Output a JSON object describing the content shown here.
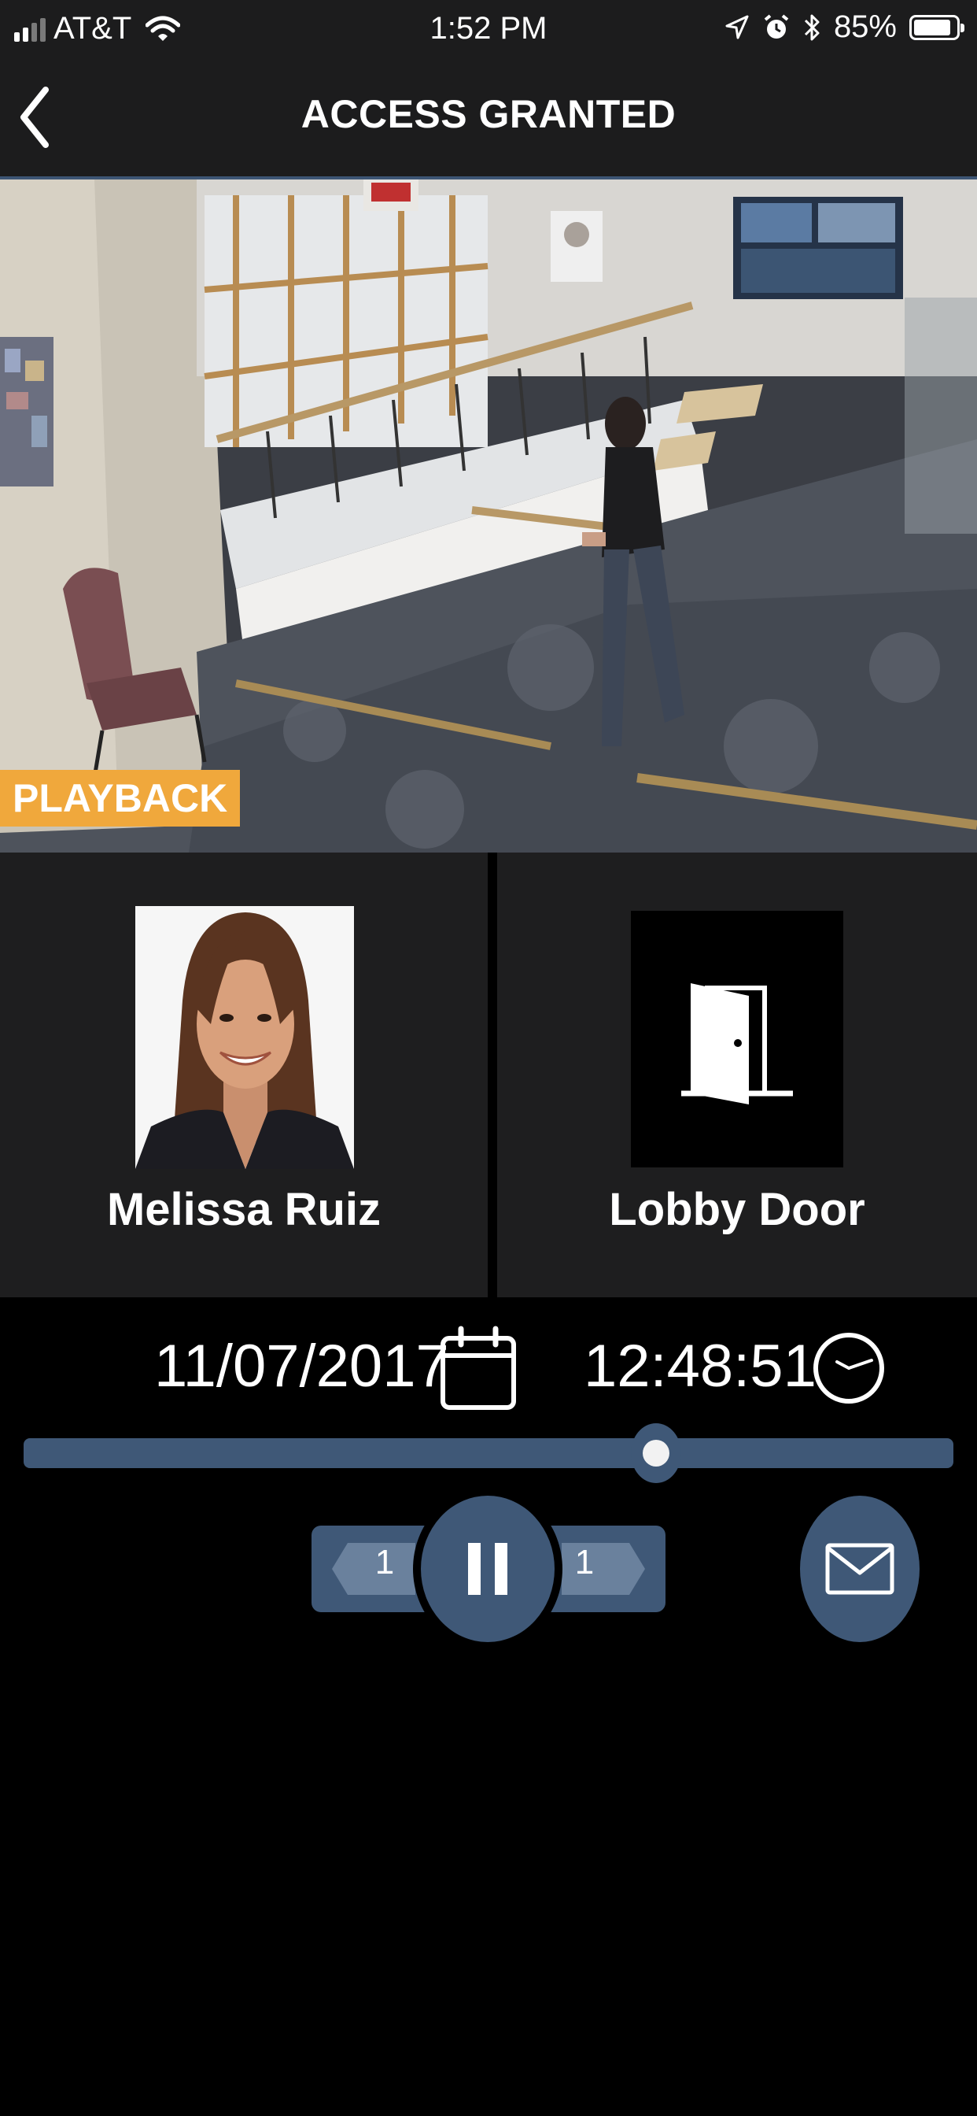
{
  "status_bar": {
    "carrier": "AT&T",
    "time": "1:52 PM",
    "battery": "85%"
  },
  "nav": {
    "title": "ACCESS GRANTED"
  },
  "video": {
    "badge": "PLAYBACK",
    "badge_color": "#f0a83c"
  },
  "person": {
    "name": "Melissa Ruiz"
  },
  "door": {
    "name": "Lobby Door"
  },
  "playback": {
    "date": "11/07/2017",
    "time": "12:48:51",
    "progress": 0.68,
    "step_back": "1",
    "step_forward": "1"
  },
  "colors": {
    "accent": "#3f5877",
    "panel": "#1e1e1f",
    "bar": "#1c1c1d"
  }
}
